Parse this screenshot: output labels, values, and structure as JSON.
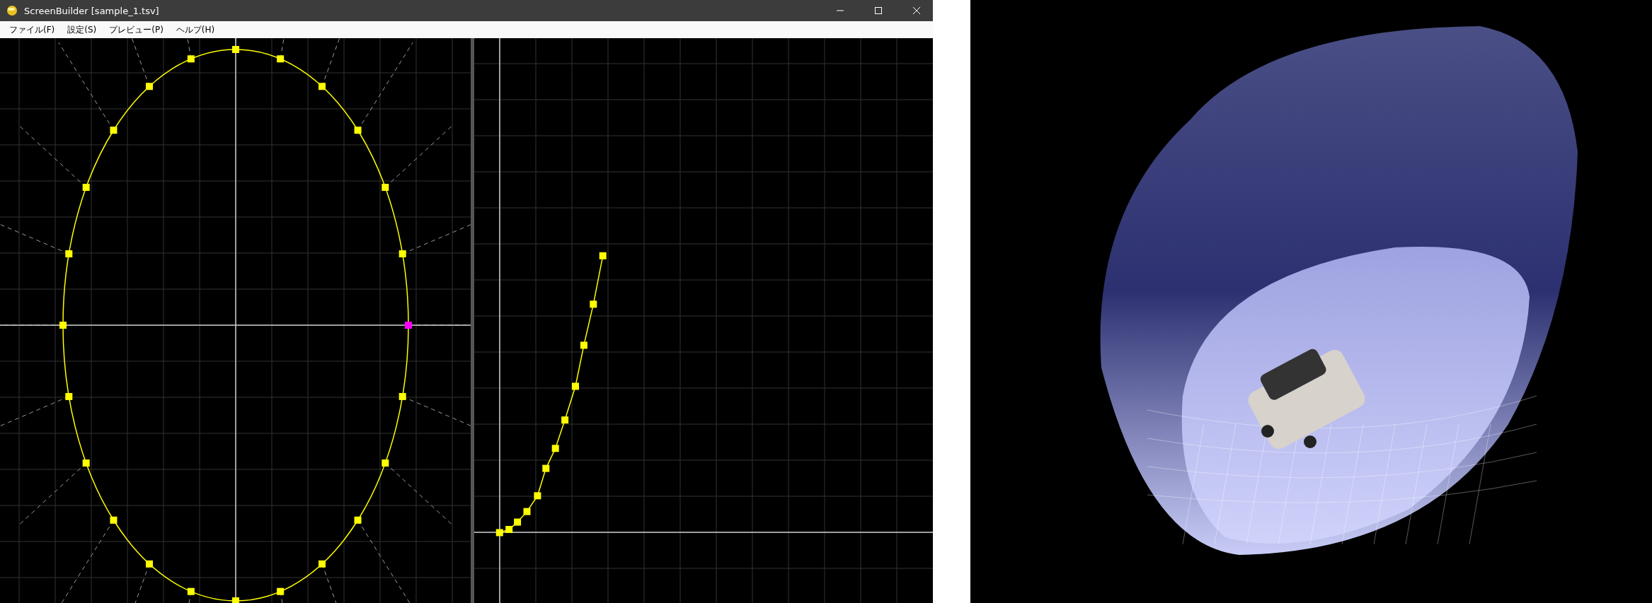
{
  "window": {
    "title": "ScreenBuilder [sample_1.tsv]"
  },
  "menu": [
    {
      "label": "ファイル(F)"
    },
    {
      "label": "設定(S)"
    },
    {
      "label": "プレビュー(P)"
    },
    {
      "label": "ヘルプ(H)"
    }
  ]
}
